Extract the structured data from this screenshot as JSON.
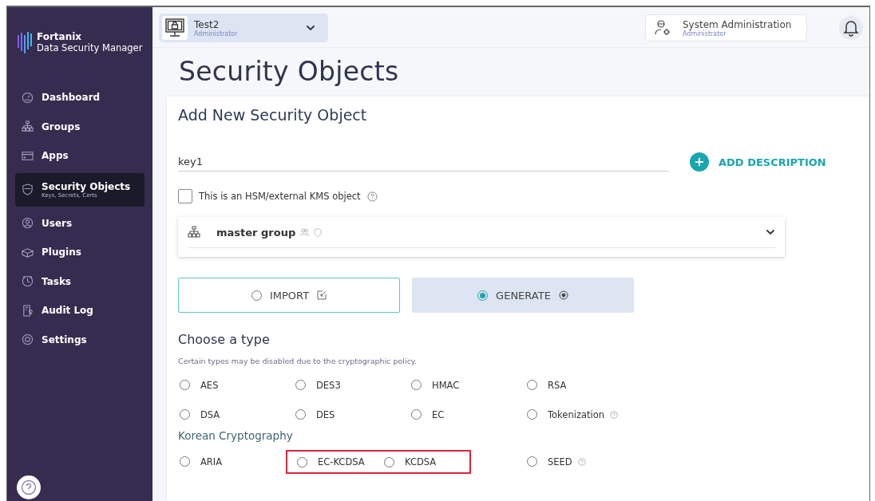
{
  "brand": {
    "name": "Fortanix",
    "product": "Data Security Manager"
  },
  "sidebar": {
    "items": [
      {
        "label": "Dashboard",
        "selected": false
      },
      {
        "label": "Groups",
        "selected": false
      },
      {
        "label": "Apps",
        "selected": false
      },
      {
        "label": "Security Objects",
        "subtitle": "Keys, Secrets, Certs",
        "selected": true
      },
      {
        "label": "Users",
        "selected": false
      },
      {
        "label": "Plugins",
        "selected": false
      },
      {
        "label": "Tasks",
        "selected": false
      },
      {
        "label": "Audit Log",
        "selected": false
      },
      {
        "label": "Settings",
        "selected": false
      }
    ]
  },
  "account_switcher": {
    "name": "Test2",
    "role": "Administrator"
  },
  "admin_button": {
    "name": "System Administration",
    "role": "Administrator"
  },
  "page_title": "Security Objects",
  "form": {
    "title": "Add New Security Object",
    "name_field": {
      "value": "key1"
    },
    "add_description": "ADD DESCRIPTION",
    "hsm_checkbox": {
      "label": "This is an HSM/external KMS object",
      "checked": false
    },
    "group": {
      "value": "master group"
    },
    "modes": [
      {
        "label": "IMPORT",
        "selected": false
      },
      {
        "label": "GENERATE",
        "selected": true
      }
    ],
    "type_heading": "Choose a type",
    "type_note": "Certain types may be disabled due to the cryptographic policy.",
    "types": [
      {
        "label": "AES",
        "selected": false,
        "hint": false
      },
      {
        "label": "DES3",
        "selected": false,
        "hint": false
      },
      {
        "label": "HMAC",
        "selected": false,
        "hint": false
      },
      {
        "label": "RSA",
        "selected": false,
        "hint": false
      },
      {
        "label": "DSA",
        "selected": false,
        "hint": false
      },
      {
        "label": "DES",
        "selected": false,
        "hint": false
      },
      {
        "label": "EC",
        "selected": false,
        "hint": false
      },
      {
        "label": "Tokenization",
        "selected": false,
        "hint": true
      }
    ],
    "korean_heading": "Korean Cryptography",
    "korean_types": [
      {
        "label": "ARIA",
        "selected": false,
        "hint": false,
        "highlighted": false
      },
      {
        "label": "EC-KCDSA",
        "selected": false,
        "hint": false,
        "highlighted": true
      },
      {
        "label": "KCDSA",
        "selected": false,
        "hint": false,
        "highlighted": true
      },
      {
        "label": "SEED",
        "selected": false,
        "hint": true,
        "highlighted": false
      }
    ]
  }
}
